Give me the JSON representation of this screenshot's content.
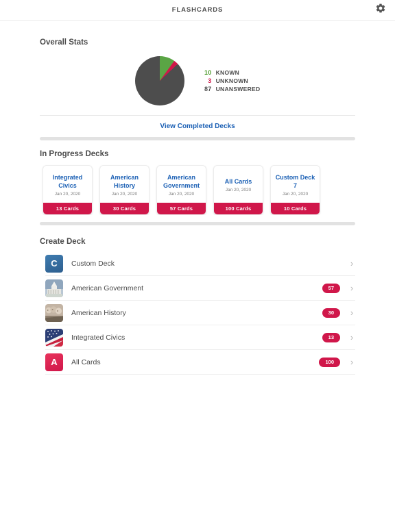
{
  "header": {
    "title": "FLASHCARDS",
    "settings_icon": "gear-icon"
  },
  "overall_stats": {
    "title": "Overall Stats",
    "view_completed_label": "View Completed Decks",
    "legend": [
      {
        "value": "10",
        "label": "KNOWN",
        "color": "#4c9a2a"
      },
      {
        "value": "3",
        "label": "UNKNOWN",
        "color": "#d0174a"
      },
      {
        "value": "87",
        "label": "UNANSWERED",
        "color": "#4b4b4b"
      }
    ]
  },
  "chart_data": {
    "type": "pie",
    "title": "Overall Stats",
    "categories": [
      "KNOWN",
      "UNKNOWN",
      "UNANSWERED"
    ],
    "values": [
      10,
      3,
      87
    ],
    "colors": [
      "#5aa545",
      "#d0174a",
      "#4d4d4d"
    ],
    "legend": "right",
    "total": 100
  },
  "in_progress": {
    "title": "In Progress Decks",
    "decks": [
      {
        "name": "Integrated Civics",
        "date": "Jan 20, 2020",
        "count": "13 Cards"
      },
      {
        "name": "American History",
        "date": "Jan 20, 2020",
        "count": "30 Cards"
      },
      {
        "name": "American Government",
        "date": "Jan 20, 2020",
        "count": "57 Cards"
      },
      {
        "name": "All Cards",
        "date": "Jan 20, 2020",
        "count": "100 Cards"
      },
      {
        "name": "Custom Deck 7",
        "date": "Jan 20, 2020",
        "count": "10 Cards"
      }
    ]
  },
  "create_deck": {
    "title": "Create Deck",
    "rows": [
      {
        "label": "Custom Deck",
        "badge": "",
        "thumb": "letter-c-tile",
        "letter": "C"
      },
      {
        "label": "American Government",
        "badge": "57",
        "thumb": "capitol-dome-image"
      },
      {
        "label": "American History",
        "badge": "30",
        "thumb": "mount-rushmore-image"
      },
      {
        "label": "Integrated Civics",
        "badge": "13",
        "thumb": "american-flag-image"
      },
      {
        "label": "All Cards",
        "badge": "100",
        "thumb": "letter-a-tile",
        "letter": "A"
      }
    ],
    "chevron": "›"
  }
}
